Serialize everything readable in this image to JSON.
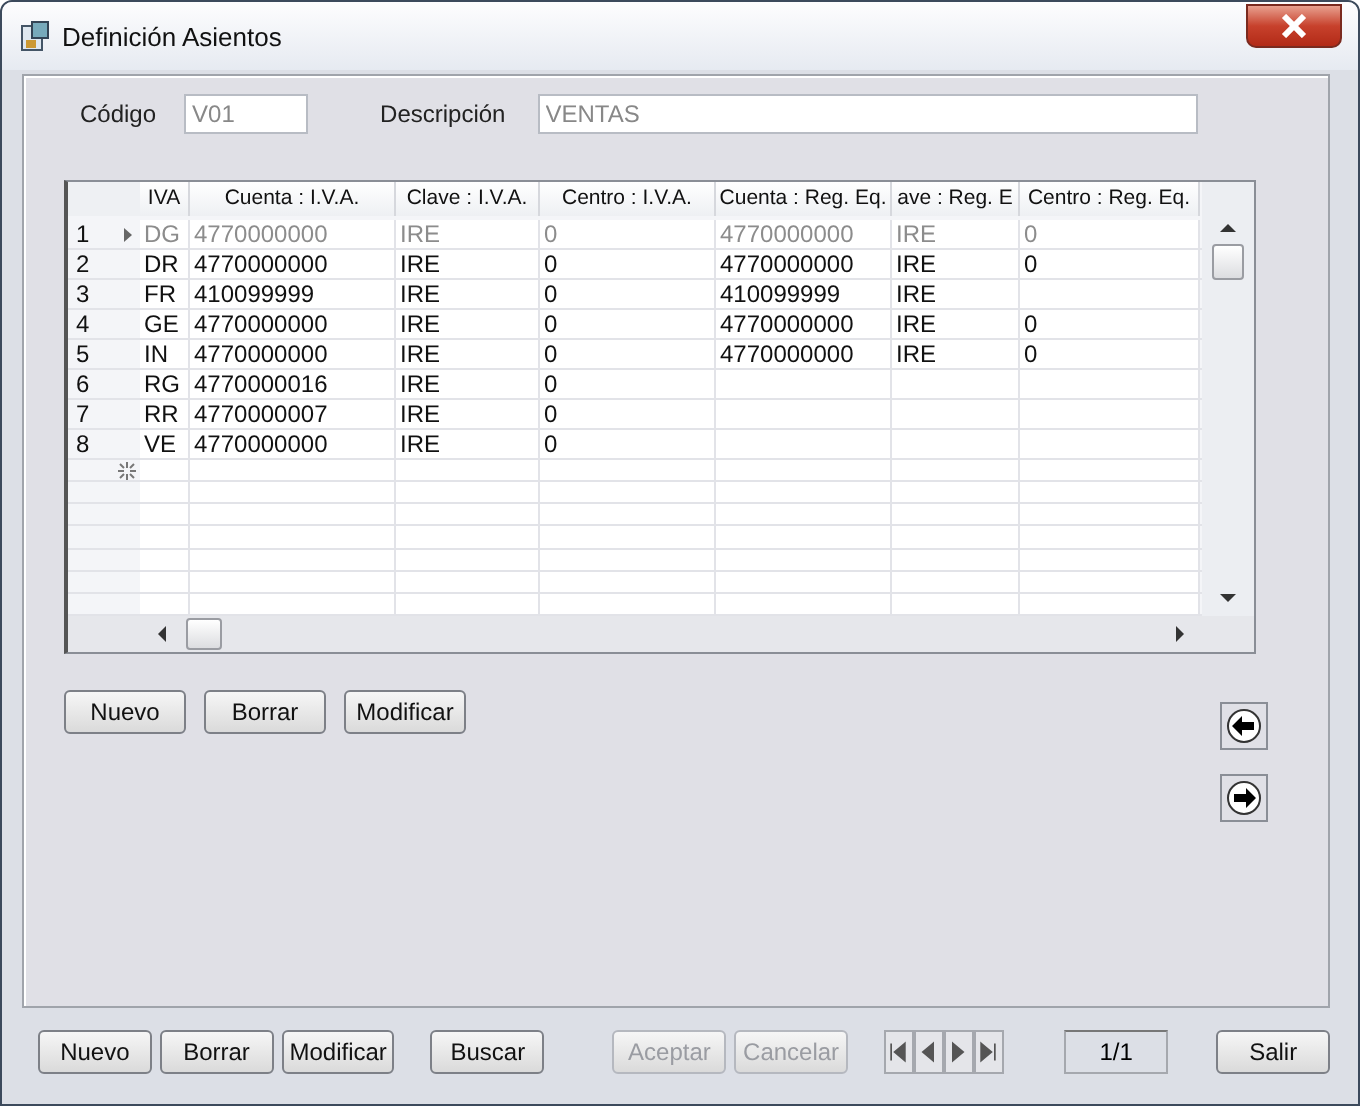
{
  "window": {
    "title": "Definición Asientos"
  },
  "fields": [
    {
      "label": "Código",
      "value": "V01"
    },
    {
      "label": "Descripción",
      "value": "VENTAS"
    }
  ],
  "table": {
    "columns": [
      "IVA",
      "Cuenta : I.V.A.",
      "Clave : I.V.A.",
      "Centro : I.V.A.",
      "Cuenta : Reg. Eq.",
      "ave : Reg. E",
      "Centro : Reg. Eq."
    ],
    "rows": [
      {
        "number": "1",
        "selected": true,
        "cells": [
          "DG",
          "4770000000",
          "IRE",
          "0",
          "4770000000",
          "IRE",
          "0"
        ]
      },
      {
        "number": "2",
        "selected": false,
        "cells": [
          "DR",
          "4770000000",
          "IRE",
          "0",
          "4770000000",
          "IRE",
          "0"
        ]
      },
      {
        "number": "3",
        "selected": false,
        "cells": [
          "FR",
          "410099999",
          "IRE",
          "0",
          "410099999",
          "IRE",
          ""
        ]
      },
      {
        "number": "4",
        "selected": false,
        "cells": [
          "GE",
          "4770000000",
          "IRE",
          "0",
          "4770000000",
          "IRE",
          "0"
        ]
      },
      {
        "number": "5",
        "selected": false,
        "cells": [
          "IN",
          "4770000000",
          "IRE",
          "0",
          "4770000000",
          "IRE",
          "0"
        ]
      },
      {
        "number": "6",
        "selected": false,
        "cells": [
          "RG",
          "4770000016",
          "IRE",
          "0",
          "",
          "",
          ""
        ]
      },
      {
        "number": "7",
        "selected": false,
        "cells": [
          "RR",
          "4770000007",
          "IRE",
          "0",
          "",
          "",
          ""
        ]
      },
      {
        "number": "8",
        "selected": false,
        "cells": [
          "VE",
          "4770000000",
          "IRE",
          "0",
          "",
          "",
          ""
        ]
      }
    ]
  },
  "grid_buttons": [
    {
      "label": "Nuevo"
    },
    {
      "label": "Borrar"
    },
    {
      "label": "Modificar"
    }
  ],
  "bottom_buttons": [
    {
      "label": "Nuevo",
      "disabled": false
    },
    {
      "label": "Borrar",
      "disabled": false
    },
    {
      "label": "Modificar",
      "disabled": false
    },
    {
      "label": "Buscar",
      "disabled": false
    }
  ],
  "action_buttons": [
    {
      "label": "Aceptar",
      "disabled": true
    },
    {
      "label": "Cancelar",
      "disabled": true
    }
  ],
  "record_counter": "1/1",
  "exit_button": {
    "label": "Salir"
  }
}
